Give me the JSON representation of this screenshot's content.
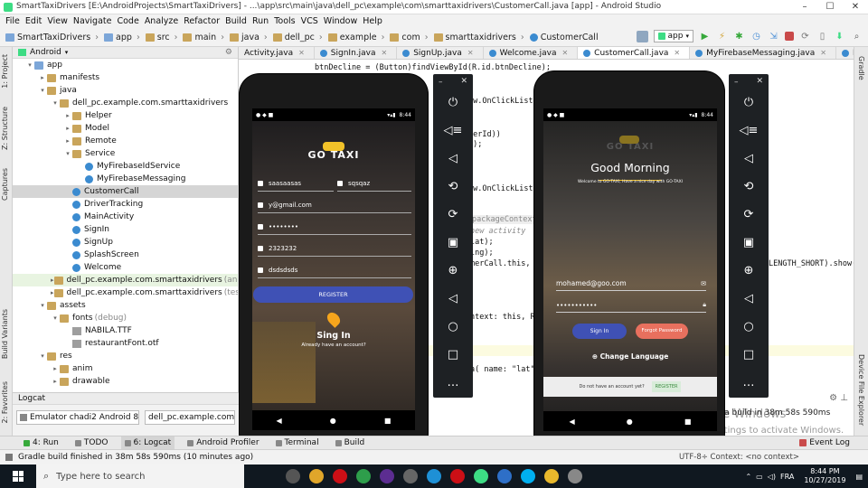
{
  "window": {
    "title": "SmartTaxiDrivers [E:\\AndroidProjects\\SmartTaxiDrivers] - ...\\app\\src\\main\\java\\dell_pc\\example\\com\\smarttaxidrivers\\CustomerCall.java [app] - Android Studio",
    "minimize": "–",
    "maximize": "☐",
    "close": "✕"
  },
  "menu": [
    "File",
    "Edit",
    "View",
    "Navigate",
    "Code",
    "Analyze",
    "Refactor",
    "Build",
    "Run",
    "Tools",
    "VCS",
    "Window",
    "Help"
  ],
  "breadcrumbs": [
    "SmartTaxiDrivers",
    "app",
    "src",
    "main",
    "java",
    "dell_pc",
    "example",
    "com",
    "smarttaxidrivers",
    "CustomerCall"
  ],
  "toolbar": {
    "run_config": "app"
  },
  "left_strip": [
    "1: Project",
    "Z: Structure",
    "Captures",
    "Build Variants",
    "2: Favorites"
  ],
  "right_strip": [
    "Gradle",
    "Device File Explorer"
  ],
  "project": {
    "header": "Android",
    "rows": [
      {
        "label": "app",
        "level": 0,
        "arrow": "▾",
        "icon": "fold blue",
        "sel": false,
        "green": false,
        "suffix": ""
      },
      {
        "label": "manifests",
        "level": 1,
        "arrow": "▸",
        "icon": "fold",
        "sel": false,
        "green": false,
        "suffix": ""
      },
      {
        "label": "java",
        "level": 1,
        "arrow": "▾",
        "icon": "fold",
        "sel": false,
        "green": false,
        "suffix": ""
      },
      {
        "label": "dell_pc.example.com.smarttaxidrivers",
        "level": 2,
        "arrow": "▾",
        "icon": "fold",
        "sel": false,
        "green": false,
        "suffix": ""
      },
      {
        "label": "Helper",
        "level": 3,
        "arrow": "▸",
        "icon": "fold",
        "sel": false,
        "green": false,
        "suffix": ""
      },
      {
        "label": "Model",
        "level": 3,
        "arrow": "▸",
        "icon": "fold",
        "sel": false,
        "green": false,
        "suffix": ""
      },
      {
        "label": "Remote",
        "level": 3,
        "arrow": "▸",
        "icon": "fold",
        "sel": false,
        "green": false,
        "suffix": ""
      },
      {
        "label": "Service",
        "level": 3,
        "arrow": "▾",
        "icon": "fold",
        "sel": false,
        "green": false,
        "suffix": ""
      },
      {
        "label": "MyFirebaseIdService",
        "level": 4,
        "arrow": "",
        "icon": "cls",
        "sel": false,
        "green": false,
        "suffix": ""
      },
      {
        "label": "MyFirebaseMessaging",
        "level": 4,
        "arrow": "",
        "icon": "cls",
        "sel": false,
        "green": false,
        "suffix": ""
      },
      {
        "label": "CustomerCall",
        "level": 3,
        "arrow": "",
        "icon": "cls",
        "sel": true,
        "green": false,
        "suffix": ""
      },
      {
        "label": "DriverTracking",
        "level": 3,
        "arrow": "",
        "icon": "cls",
        "sel": false,
        "green": false,
        "suffix": ""
      },
      {
        "label": "MainActivity",
        "level": 3,
        "arrow": "",
        "icon": "cls",
        "sel": false,
        "green": false,
        "suffix": ""
      },
      {
        "label": "SignIn",
        "level": 3,
        "arrow": "",
        "icon": "cls",
        "sel": false,
        "green": false,
        "suffix": ""
      },
      {
        "label": "SignUp",
        "level": 3,
        "arrow": "",
        "icon": "cls",
        "sel": false,
        "green": false,
        "suffix": ""
      },
      {
        "label": "SplashScreen",
        "level": 3,
        "arrow": "",
        "icon": "cls",
        "sel": false,
        "green": false,
        "suffix": ""
      },
      {
        "label": "Welcome",
        "level": 3,
        "arrow": "",
        "icon": "cls",
        "sel": false,
        "green": false,
        "suffix": ""
      },
      {
        "label": "dell_pc.example.com.smarttaxidrivers",
        "level": 2,
        "arrow": "▸",
        "icon": "fold",
        "sel": false,
        "green": true,
        "suffix": "(androidTest)"
      },
      {
        "label": "dell_pc.example.com.smarttaxidrivers",
        "level": 2,
        "arrow": "▸",
        "icon": "fold",
        "sel": false,
        "green": false,
        "suffix": "(test)"
      },
      {
        "label": "assets",
        "level": 1,
        "arrow": "▾",
        "icon": "fold",
        "sel": false,
        "green": false,
        "suffix": ""
      },
      {
        "label": "fonts",
        "level": 2,
        "arrow": "▾",
        "icon": "fold",
        "sel": false,
        "green": false,
        "suffix": "(debug)"
      },
      {
        "label": "NABILA.TTF",
        "level": 3,
        "arrow": "",
        "icon": "file",
        "sel": false,
        "green": false,
        "suffix": ""
      },
      {
        "label": "restaurantFont.otf",
        "level": 3,
        "arrow": "",
        "icon": "file",
        "sel": false,
        "green": false,
        "suffix": ""
      },
      {
        "label": "res",
        "level": 1,
        "arrow": "▾",
        "icon": "fold",
        "sel": false,
        "green": false,
        "suffix": ""
      },
      {
        "label": "anim",
        "level": 2,
        "arrow": "▸",
        "icon": "fold",
        "sel": false,
        "green": false,
        "suffix": ""
      },
      {
        "label": "drawable",
        "level": 2,
        "arrow": "▸",
        "icon": "fold",
        "sel": false,
        "green": false,
        "suffix": ""
      }
    ]
  },
  "logcat": {
    "title": "Logcat",
    "device": "Emulator chadi2 Android 8.0",
    "process": "dell_pc.example.com.smar"
  },
  "tabs": [
    {
      "label": "Activity.java",
      "active": false
    },
    {
      "label": "SignIn.java",
      "active": false
    },
    {
      "label": "SignUp.java",
      "active": false
    },
    {
      "label": "Welcome.java",
      "active": false
    },
    {
      "label": "CustomerCall.java",
      "active": true
    },
    {
      "label": "MyFirebaseMessaging.java",
      "active": false
    },
    {
      "label": "MyFirebaseIdService.java",
      "active": false
    }
  ],
  "code": {
    "l1": "btnDecline = (Button)findViewById(R.id.btnDecline);",
    "l2": "ew.OnClickList",
    "l3": "merId))",
    "l4": "d);",
    "l5": "ew.OnClickListe",
    "l6": "packageContext: C",
    "l7": "new activity",
    "l8": "lat);",
    "l9": "lng);",
    "l10": "merCall.this,",
    "l11": "LENGTH_SHORT).show();",
    "l12": "ntext:  this, R.r",
    "l13": "a( name: \"lat\","
  },
  "phone1": {
    "time": "8:44",
    "logo": "GO TAXI",
    "first_name": "saasaasas",
    "last_name": "sqsqaz",
    "email": "y@gmail.com",
    "password": "••••••••",
    "phone": "2323232",
    "username": "dsdsdsds",
    "register": "REGISTER",
    "signin": "Sing In",
    "have_account": "Already have an account?"
  },
  "phone2": {
    "time": "8:44",
    "logo": "GO TAXI",
    "greeting": "Good Morning",
    "welcome": "Welcome to GO-TAXI, Have a nice day with GO-TAXI",
    "email": "mohamed@goo.com",
    "password": "•••••••••••",
    "signin": "Sign In",
    "forgot": "Forgot Password",
    "language": "Change Language",
    "no_account": "Do not have an account yet?",
    "register": "REGISTER"
  },
  "emulator_icons": [
    "power-icon",
    "volume-up-icon",
    "volume-down-icon",
    "rotate-left-icon",
    "rotate-right-icon",
    "camera-icon",
    "zoom-icon",
    "back-icon",
    "home-icon",
    "overview-icon",
    "more-icon"
  ],
  "activate": {
    "title": "Activate Windows",
    "sub": "Go to Settings to activate Windows."
  },
  "event_msg": "ed a build in 38m 58s 590ms",
  "bottom_tabs": [
    "4: Run",
    "TODO",
    "6: Logcat",
    "Android Profiler",
    "Terminal",
    "Build"
  ],
  "event_log": "Event Log",
  "status": {
    "message": "Gradle build finished in 38m 58s 590ms (10 minutes ago)",
    "right": "UTF-8÷   Context: <no context>"
  },
  "taskbar": {
    "search": "Type here to search",
    "time": "8:44 PM",
    "date": "10/27/2019",
    "lang": "FRA"
  },
  "colors": {
    "accent": "#3f51b5",
    "forgot": "#e8705e",
    "run": "#37a93b",
    "taskbar": "#101820"
  }
}
